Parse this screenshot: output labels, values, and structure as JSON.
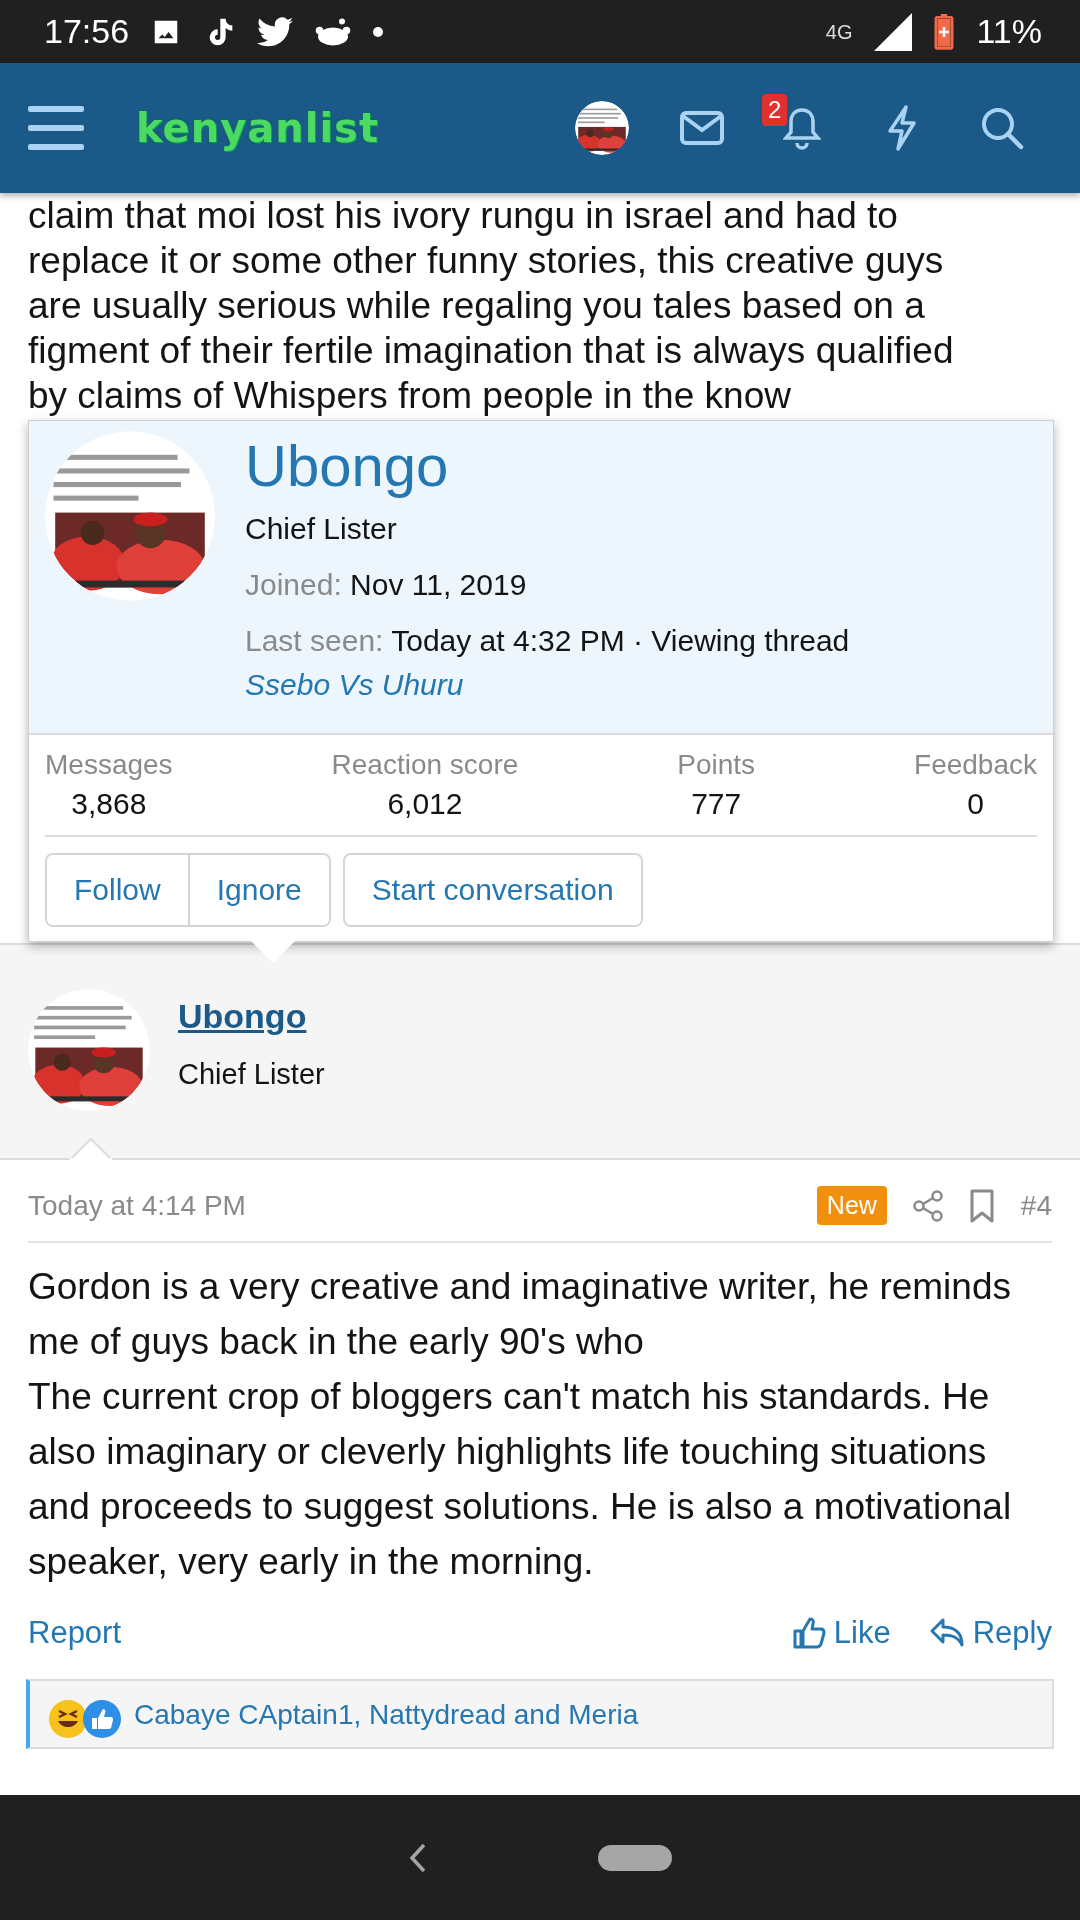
{
  "status_bar": {
    "time": "17:56",
    "network": "4G",
    "battery": "11%"
  },
  "header": {
    "logo": "kenyanlist",
    "notification_count": "2"
  },
  "previous_post": {
    "lines": [
      "claim that moi lost his ivory rungu in israel and had to",
      "replace it or some other funny stories, this creative guys",
      "are usually serious while regaling you tales based on a",
      "figment of their fertile imagination that is always qualified",
      "by claims of Whispers from people in the know"
    ]
  },
  "member_card": {
    "name": "Ubongo",
    "title": "Chief Lister",
    "joined_label": "Joined:",
    "joined_value": "Nov 11, 2019",
    "last_seen_label": "Last seen:",
    "last_seen_value": "Today at 4:32 PM · Viewing thread",
    "thread_link": "Ssebo Vs Uhuru",
    "stats": [
      {
        "label": "Messages",
        "value": "3,868"
      },
      {
        "label": "Reaction score",
        "value": "6,012"
      },
      {
        "label": "Points",
        "value": "777"
      },
      {
        "label": "Feedback",
        "value": "0"
      }
    ],
    "button_groups": [
      [
        "Follow",
        "Ignore"
      ],
      [
        "Start conversation"
      ]
    ]
  },
  "post": {
    "author": "Ubongo",
    "author_title": "Chief Lister",
    "time": "Today at 4:14 PM",
    "badge": "New",
    "number": "#4",
    "paragraphs": [
      "Gordon is a very creative and imaginative writer, he reminds me of guys back in the early 90's who",
      "The current crop of bloggers can't match his standards. He also imaginary or cleverly highlights life touching situations and proceeds to suggest solutions. He is also a motivational speaker, very early in the morning."
    ],
    "actions": {
      "report": "Report",
      "like": "Like",
      "reply": "Reply"
    },
    "reactions": "Cabaye CAptain1, Nattydread and Meria"
  }
}
